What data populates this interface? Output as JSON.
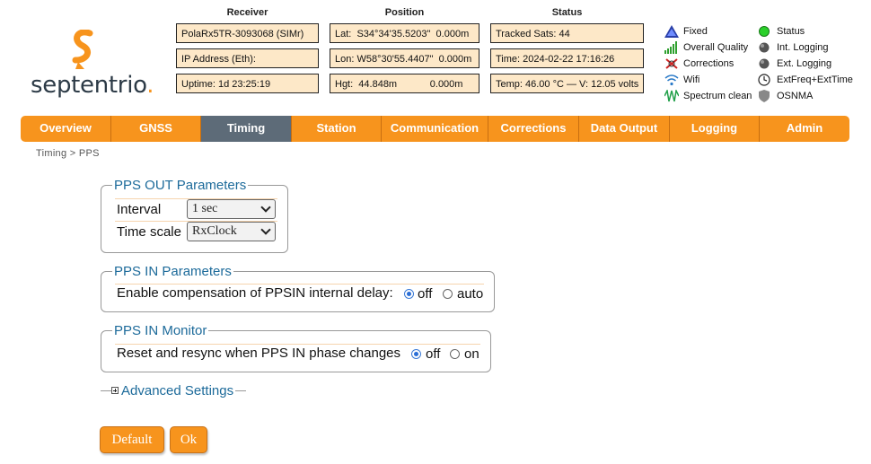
{
  "brand": {
    "logo_text": "septentrio"
  },
  "header": {
    "receiver": {
      "title": "Receiver",
      "name": "PolaRx5TR-3093068 (SIMr)",
      "ip": "IP Address (Eth):",
      "uptime": "Uptime: 1d 23:25:19"
    },
    "position": {
      "title": "Position",
      "lat": "Lat:  S34°34'35.5203\"  0.000m",
      "lon": "Lon: W58°30'55.4407\"  0.000m",
      "hgt": "Hgt:  44.848m            0.000m"
    },
    "status": {
      "title": "Status",
      "sats": "Tracked Sats: 44",
      "time": "Time: 2024-02-22 17:16:26",
      "temp": "Temp: 46.00 °C — V: 12.05 volts"
    }
  },
  "legend": {
    "left": [
      {
        "label": "Fixed",
        "icon": "fixed-triangle-icon"
      },
      {
        "label": "Overall Quality",
        "icon": "signal-bars-icon"
      },
      {
        "label": "Corrections",
        "icon": "corrections-icon"
      },
      {
        "label": "Wifi",
        "icon": "wifi-icon"
      },
      {
        "label": "Spectrum clean",
        "icon": "spectrum-icon"
      }
    ],
    "right": [
      {
        "label": "Status",
        "icon": "status-led-icon"
      },
      {
        "label": "Int. Logging",
        "icon": "int-logging-icon"
      },
      {
        "label": "Ext. Logging",
        "icon": "ext-logging-icon"
      },
      {
        "label": "ExtFreq+ExtTime",
        "icon": "clock-icon"
      },
      {
        "label": "OSNMA",
        "icon": "shield-icon"
      }
    ]
  },
  "nav": {
    "tabs": [
      "Overview",
      "GNSS",
      "Timing",
      "Station",
      "Communication",
      "Corrections",
      "Data Output",
      "Logging",
      "Admin"
    ],
    "active": "Timing"
  },
  "breadcrumb": "Timing > PPS",
  "pps_out": {
    "legend": "PPS OUT Parameters",
    "interval": {
      "label": "Interval",
      "value": "1 sec"
    },
    "timescale": {
      "label": "Time scale",
      "value": "RxClock"
    }
  },
  "pps_in": {
    "legend": "PPS IN Parameters",
    "label": "Enable compensation of PPSIN internal delay:",
    "options": [
      "off",
      "auto"
    ],
    "selected": "off"
  },
  "pps_monitor": {
    "legend": "PPS IN Monitor",
    "label": "Reset and resync when PPS IN phase changes",
    "options": [
      "off",
      "on"
    ],
    "selected": "off"
  },
  "advanced": {
    "label": "Advanced Settings"
  },
  "buttons": {
    "default": "Default",
    "ok": "Ok"
  },
  "colors": {
    "accent": "#f7941d",
    "active_tab": "#5d6b78",
    "legend_text": "#1c6a9a",
    "info_box": "#fde8c8"
  }
}
